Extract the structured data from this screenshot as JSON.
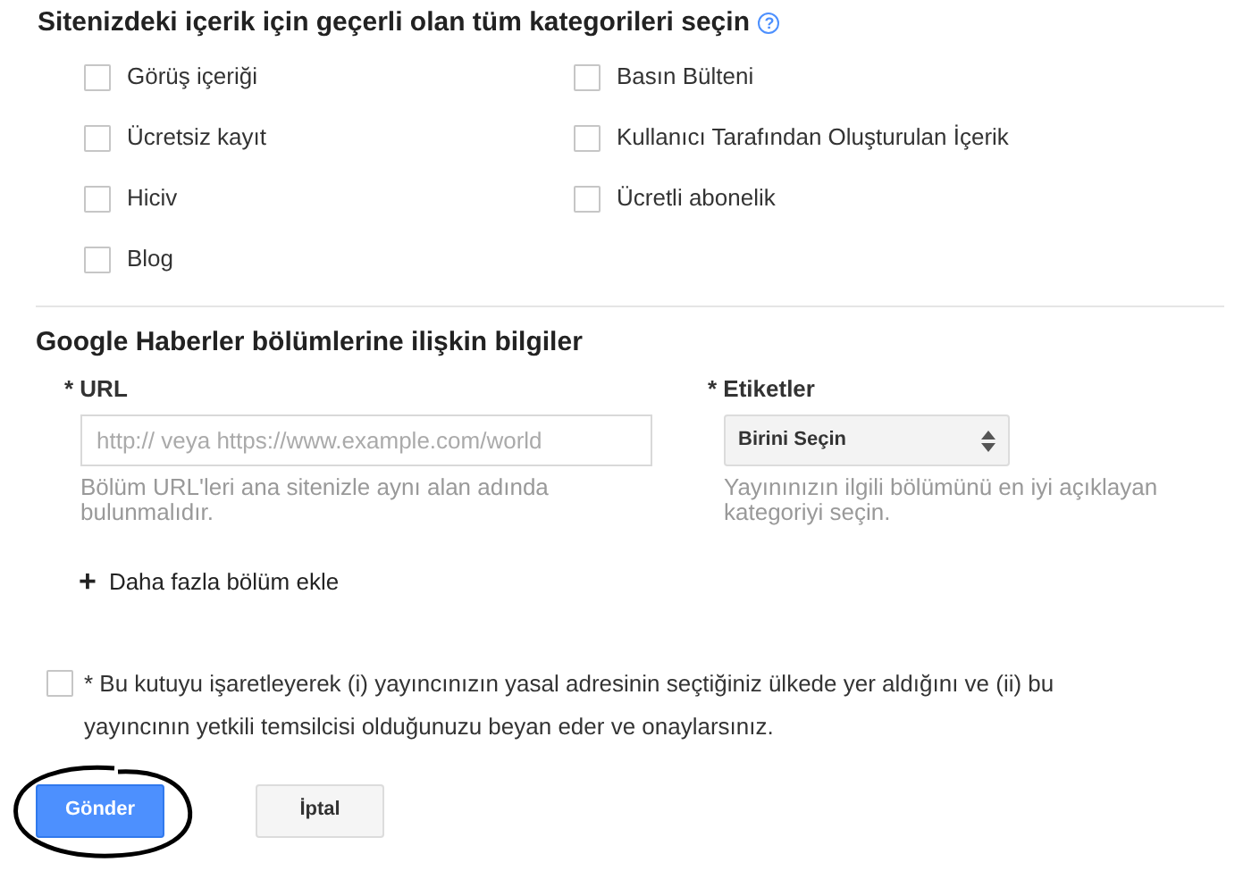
{
  "categories_section": {
    "title": "Sitenizdeki içerik için geçerli olan tüm kategorileri seçin",
    "help_icon": "?",
    "categories": [
      {
        "label": "Görüş içeriği",
        "checked": false
      },
      {
        "label": "Basın Bülteni",
        "checked": false
      },
      {
        "label": "Ücretsiz kayıt",
        "checked": false
      },
      {
        "label": "Kullanıcı Tarafından Oluşturulan İçerik",
        "checked": false
      },
      {
        "label": "Hiciv",
        "checked": false
      },
      {
        "label": "Ücretli abonelik",
        "checked": false
      },
      {
        "label": "Blog",
        "checked": false
      }
    ]
  },
  "sections_info": {
    "title": "Google Haberler bölümlerine ilişkin bilgiler",
    "url": {
      "label": "* URL",
      "placeholder": "http:// veya https://www.example.com/world",
      "help": "Bölüm URL'leri ana sitenizle aynı alan adında bulunmalıdır."
    },
    "labels": {
      "label": "* Etiketler",
      "value": "Birini Seçin",
      "help": "Yayınınızın ilgili bölümünü en iyi açıklayan kategoriyi seçin."
    },
    "add_more": {
      "icon": "+",
      "label": "Daha fazla bölüm ekle"
    }
  },
  "consent": {
    "checked": false,
    "text": "* Bu kutuyu işaretleyerek (i) yayıncınızın yasal adresinin seçtiğiniz ülkede yer aldığını ve (ii) bu yayıncının yetkili temsilcisi olduğunuzu beyan eder ve onaylarsınız."
  },
  "buttons": [
    {
      "label": "Gönder",
      "kind": "primary",
      "circled": true
    },
    {
      "label": "İptal",
      "kind": "secondary",
      "circled": false
    }
  ]
}
